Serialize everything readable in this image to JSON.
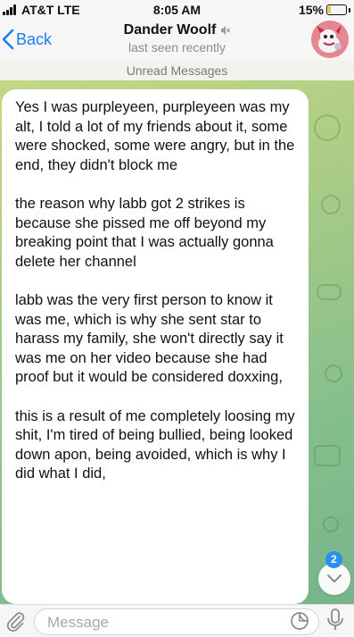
{
  "status_bar": {
    "carrier": "AT&T  LTE",
    "time": "8:05 AM",
    "battery_percent": "15%",
    "battery_level": 0.15,
    "battery_color": "#e3c43a"
  },
  "header": {
    "back_label": "Back",
    "title": "Dander Woolf",
    "muted_icon": "muted-icon",
    "subtitle": "last seen recently",
    "accent_color": "#1a7ef3"
  },
  "chat": {
    "unread_label": "Unread Messages",
    "message_paragraphs": [
      "Yes I was purpleyeen, purpleyeen was my alt, I told a lot of my friends about it, some were shocked, some were angry, but in the end, they didn't block me",
      "the reason why labb got 2 strikes is because she pissed me off beyond my breaking point that I was actually gonna delete her channel",
      "labb was the very first person to know it was me, which is why she sent star to harass my family, she won't directly say it was me on her video because she had proof but it would be considered doxxing,",
      "this is a result of me completely loosing my shit, I'm tired of being bullied, being looked down apon, being avoided, which is why I did what I did,"
    ],
    "unread_count": "2"
  },
  "input": {
    "placeholder": "Message",
    "icons": [
      "paperclip-icon",
      "sticker-icon",
      "microphone-icon"
    ]
  }
}
